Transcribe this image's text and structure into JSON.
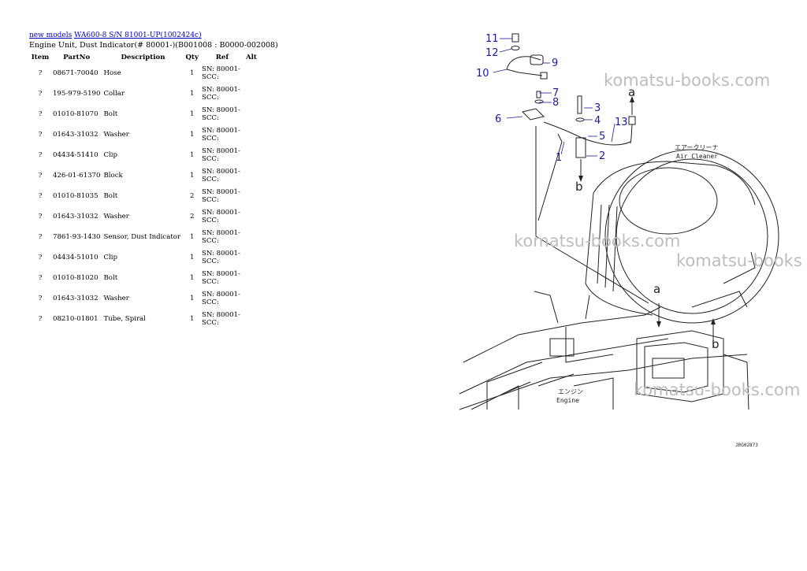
{
  "breadcrumb": {
    "link1": "new models",
    "link2": "WA600-8 S/N  81001-UP(1002424c)"
  },
  "subtitle": "Engine Unit, Dust Indicator(# 80001-)(B001008 : B0000-002008)",
  "table": {
    "headers": [
      "Item",
      "PartNo",
      "Description",
      "Qty",
      "Ref",
      "Alt"
    ],
    "rows": [
      {
        "item": "?",
        "part": "08671-70040",
        "desc": "Hose",
        "qty": "1",
        "ref1": "SN: 80001-",
        "ref2": "SCC:"
      },
      {
        "item": "?",
        "part": "195-979-5190",
        "desc": "Collar",
        "qty": "1",
        "ref1": "SN: 80001-",
        "ref2": "SCC:"
      },
      {
        "item": "?",
        "part": "01010-81070",
        "desc": "Bolt",
        "qty": "1",
        "ref1": "SN: 80001-",
        "ref2": "SCC:"
      },
      {
        "item": "?",
        "part": "01643-31032",
        "desc": "Washer",
        "qty": "1",
        "ref1": "SN: 80001-",
        "ref2": "SCC:"
      },
      {
        "item": "?",
        "part": "04434-51410",
        "desc": "Clip",
        "qty": "1",
        "ref1": "SN: 80001-",
        "ref2": "SCC:"
      },
      {
        "item": "?",
        "part": "426-01-61370",
        "desc": "Block",
        "qty": "1",
        "ref1": "SN: 80001-",
        "ref2": "SCC:"
      },
      {
        "item": "?",
        "part": "01010-81035",
        "desc": "Bolt",
        "qty": "2",
        "ref1": "SN: 80001-",
        "ref2": "SCC:"
      },
      {
        "item": "?",
        "part": "01643-31032",
        "desc": "Washer",
        "qty": "2",
        "ref1": "SN: 80001-",
        "ref2": "SCC:"
      },
      {
        "item": "?",
        "part": "7861-93-1430",
        "desc": "Sensor, Dust Indicator",
        "qty": "1",
        "ref1": "SN: 80001-",
        "ref2": "SCC:"
      },
      {
        "item": "?",
        "part": "04434-51010",
        "desc": "Clip",
        "qty": "1",
        "ref1": "SN: 80001-",
        "ref2": "SCC:"
      },
      {
        "item": "?",
        "part": "01010-81020",
        "desc": "Bolt",
        "qty": "1",
        "ref1": "SN: 80001-",
        "ref2": "SCC:"
      },
      {
        "item": "?",
        "part": "01643-31032",
        "desc": "Washer",
        "qty": "1",
        "ref1": "SN: 80001-",
        "ref2": "SCC:"
      },
      {
        "item": "?",
        "part": "08210-01801",
        "desc": "Tube, Spiral",
        "qty": "1",
        "ref1": "SN: 80001-",
        "ref2": "SCC:"
      }
    ]
  },
  "diagram": {
    "callouts": [
      "11",
      "12",
      "9",
      "10",
      "7",
      "8",
      "6",
      "3",
      "4",
      "13",
      "5",
      "1",
      "2",
      "a",
      "b",
      "a",
      "b"
    ],
    "air_cleaner_jp": "エアークリーナ",
    "air_cleaner_en": "Air Cleaner",
    "engine_jp": "エンジン",
    "engine_en": "Engine",
    "figure_code": "JRG02873",
    "watermarks": [
      "komatsu-books.com",
      "komatsu-books.com",
      "komatsu-books",
      "komatsu-books.com"
    ]
  }
}
